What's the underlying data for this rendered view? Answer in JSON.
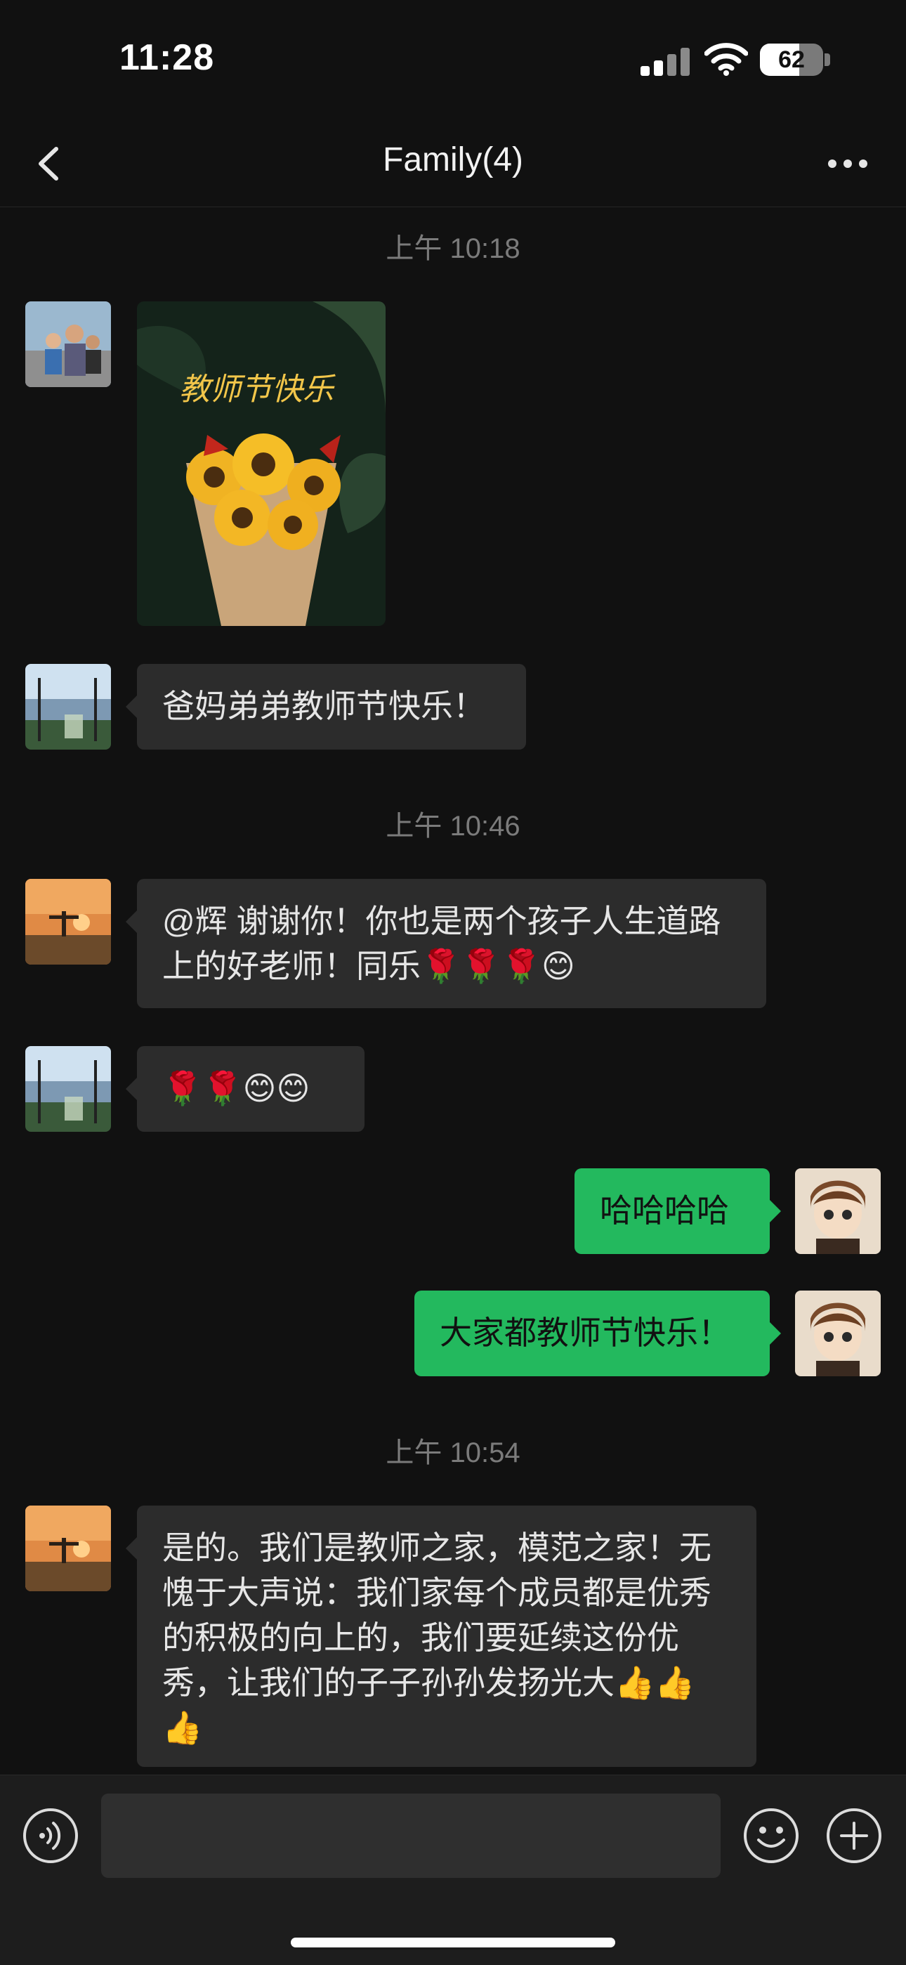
{
  "status_bar": {
    "time": "11:28",
    "battery_level": "62"
  },
  "nav": {
    "title": "Family(4)"
  },
  "messages": [
    {
      "kind": "timestamp",
      "text": "上午 10:18"
    },
    {
      "kind": "image",
      "direction": "in",
      "sender_avatar": "group-photo-avatar",
      "image_text": "教师节快乐"
    },
    {
      "kind": "text",
      "direction": "in",
      "sender_avatar": "seaside-avatar",
      "text": "爸妈弟弟教师节快乐！"
    },
    {
      "kind": "timestamp",
      "text": "上午 10:46"
    },
    {
      "kind": "text",
      "direction": "in",
      "sender_avatar": "sunset-avatar",
      "text": "@辉 谢谢你！你也是两个孩子人生道路上的好老师！同乐🌹🌹🌹😊"
    },
    {
      "kind": "text",
      "direction": "in",
      "sender_avatar": "seaside-avatar",
      "text": "🌹🌹😊😊"
    },
    {
      "kind": "text",
      "direction": "out",
      "sender_avatar": "cartoon-avatar",
      "text": "哈哈哈哈"
    },
    {
      "kind": "text",
      "direction": "out",
      "sender_avatar": "cartoon-avatar",
      "text": "大家都教师节快乐！"
    },
    {
      "kind": "timestamp",
      "text": "上午 10:54"
    },
    {
      "kind": "text",
      "direction": "in",
      "sender_avatar": "sunset-avatar",
      "text": "是的。我们是教师之家，模范之家！无愧于大声说：我们家每个成员都是优秀的积极的向上的，我们要延续这份优秀，让我们的子子孙孙发扬光大👍👍👍"
    }
  ],
  "input_bar": {
    "placeholder": "",
    "icons": [
      "voice-icon",
      "emoji-icon",
      "plus-icon"
    ]
  },
  "colors": {
    "background": "#111111",
    "incoming_bubble": "#2c2c2c",
    "outgoing_bubble": "#23b95e",
    "timestamp_text": "#7b7b7b"
  }
}
